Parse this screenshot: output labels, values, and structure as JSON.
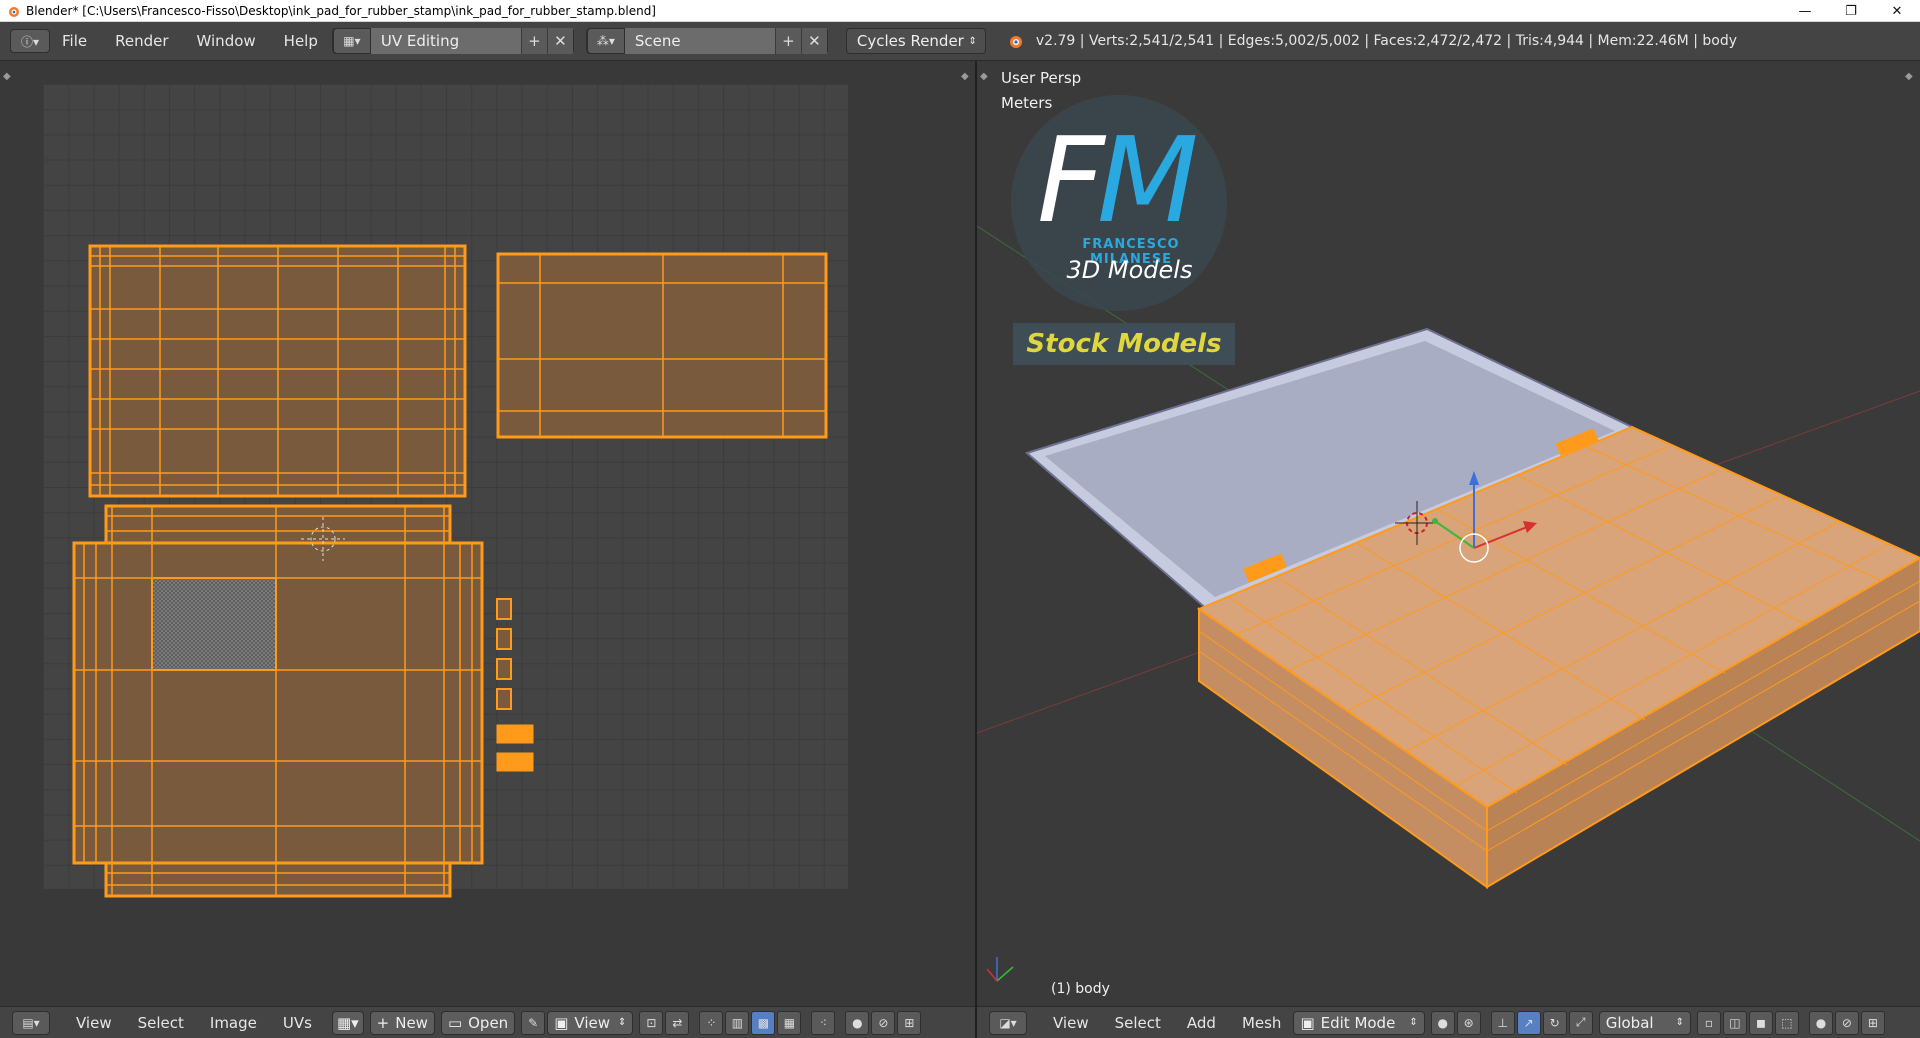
{
  "window": {
    "title": "Blender* [C:\\Users\\Francesco-Fisso\\Desktop\\ink_pad_for_rubber_stamp\\ink_pad_for_rubber_stamp.blend]",
    "minimize": "—",
    "maximize": "❐",
    "close": "✕"
  },
  "info_header": {
    "editor_icon": "info-icon",
    "menus": [
      "File",
      "Render",
      "Window",
      "Help"
    ],
    "screen_layout": "UV Editing",
    "scene": "Scene",
    "render_engine": "Cycles Render",
    "stats": "v2.79 | Verts:2,541/2,541 | Edges:5,002/5,002 | Faces:2,472/2,472 | Tris:4,944 | Mem:22.46M | body"
  },
  "viewport": {
    "view_name": "User Persp",
    "units": "Meters",
    "object_label": "(1) body"
  },
  "logo": {
    "letters_f": "F",
    "letters_m": "M",
    "name": "FRANCESCO MILANESE",
    "tagline": "3D Models",
    "badge": "Stock Models"
  },
  "uv_footer": {
    "menus": [
      "View",
      "Select",
      "Image",
      "UVs"
    ],
    "new_label": "New",
    "open_label": "Open",
    "view_label": "View"
  },
  "v3d_footer": {
    "menus": [
      "View",
      "Select",
      "Add",
      "Mesh"
    ],
    "mode": "Edit Mode",
    "orientation": "Global"
  },
  "colors": {
    "accent_orange": "#ff9a1a",
    "face_fill": "#7a5a3c",
    "active_blue": "#5680c2",
    "logo_blue": "#2aa8e0",
    "badge_yellow": "#e0d63e"
  }
}
